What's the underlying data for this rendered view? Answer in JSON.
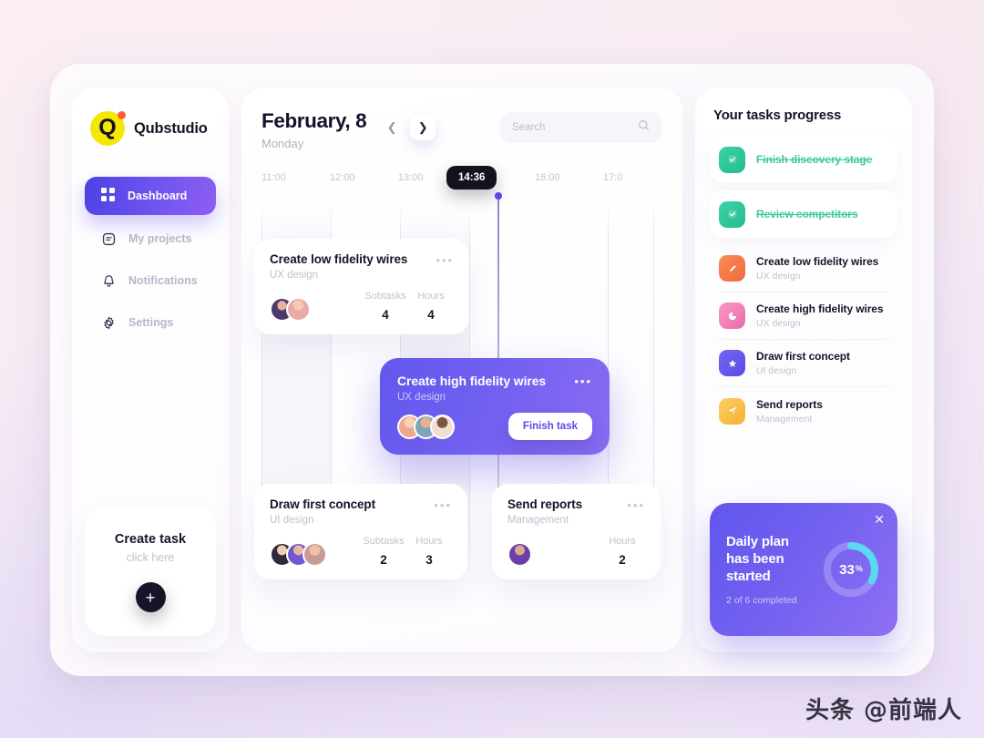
{
  "brand": {
    "name": "Qubstudio",
    "logo_letter": "Q",
    "accent": "#f5e800",
    "dot_color": "#ff5d3b"
  },
  "sidebar": {
    "items": [
      {
        "label": "Dashboard",
        "icon": "grid-icon",
        "active": true
      },
      {
        "label": "My projects",
        "icon": "document-icon",
        "active": false
      },
      {
        "label": "Notifications",
        "icon": "bell-icon",
        "active": false
      },
      {
        "label": "Settings",
        "icon": "gear-icon",
        "active": false
      }
    ],
    "create_task": {
      "title": "Create task",
      "subtitle": "click here",
      "button_icon": "plus-icon"
    }
  },
  "header": {
    "date": "February, 8",
    "weekday": "Monday",
    "prev_icon": "chevron-left-icon",
    "next_icon": "chevron-right-icon",
    "search_placeholder": "Search",
    "search_icon": "search-icon"
  },
  "timeline": {
    "ticks": [
      "11:00",
      "12:00",
      "13:00",
      "",
      "16:00",
      "17:0"
    ],
    "current_time": "14:36",
    "accent": "#5b4ae8"
  },
  "tasks": [
    {
      "title": "Create low fidelity wires",
      "category": "UX design",
      "menu_icon": "more-dots-icon",
      "metrics": [
        {
          "label": "Subtasks",
          "value": "4"
        },
        {
          "label": "Hours",
          "value": "4"
        }
      ],
      "avatars": 2,
      "active": false
    },
    {
      "title": "Create high fidelity wires",
      "category": "UX design",
      "menu_icon": "more-dots-icon",
      "action_label": "Finish task",
      "avatars": 3,
      "active": true
    },
    {
      "title": "Draw first concept",
      "category": "UI design",
      "menu_icon": "more-dots-icon",
      "metrics": [
        {
          "label": "Subtasks",
          "value": "2"
        },
        {
          "label": "Hours",
          "value": "3"
        }
      ],
      "avatars": 3,
      "active": false
    },
    {
      "title": "Send reports",
      "category": "Management",
      "menu_icon": "more-dots-icon",
      "metrics": [
        {
          "label": "Hours",
          "value": "2"
        }
      ],
      "avatars": 1,
      "active": false
    }
  ],
  "progress_panel": {
    "title": "Your tasks progress",
    "items": [
      {
        "label": "Finish discovery stage",
        "category": "",
        "icon": "check-icon",
        "icon_color": "#2dc79a",
        "done": true
      },
      {
        "label": "Review competitors",
        "category": "",
        "icon": "check-icon",
        "icon_color": "#2dc79a",
        "done": true
      },
      {
        "label": "Create low fidelity wires",
        "category": "UX design",
        "icon": "pencil-icon",
        "icon_color": "#f4794a",
        "done": false
      },
      {
        "label": "Create high fidelity wires",
        "category": "UX design",
        "icon": "pie-icon",
        "icon_color": "#f07ab4",
        "done": false
      },
      {
        "label": "Draw first concept",
        "category": "UI design",
        "icon": "star-icon",
        "icon_color": "#6257ee",
        "done": false
      },
      {
        "label": "Send reports",
        "category": "Management",
        "icon": "send-icon",
        "icon_color": "#f7c04a",
        "done": false
      }
    ]
  },
  "daily_plan": {
    "title": "Daily plan has been started",
    "subtitle": "2 of 6 completed",
    "percent_value": "33",
    "percent_symbol": "%",
    "percent_number": 33,
    "close_icon": "close-icon",
    "ring_color": "#5ad9f0",
    "track_color": "rgba(255,255,255,0.22)"
  },
  "watermark": {
    "text": "头条 @前端人"
  }
}
